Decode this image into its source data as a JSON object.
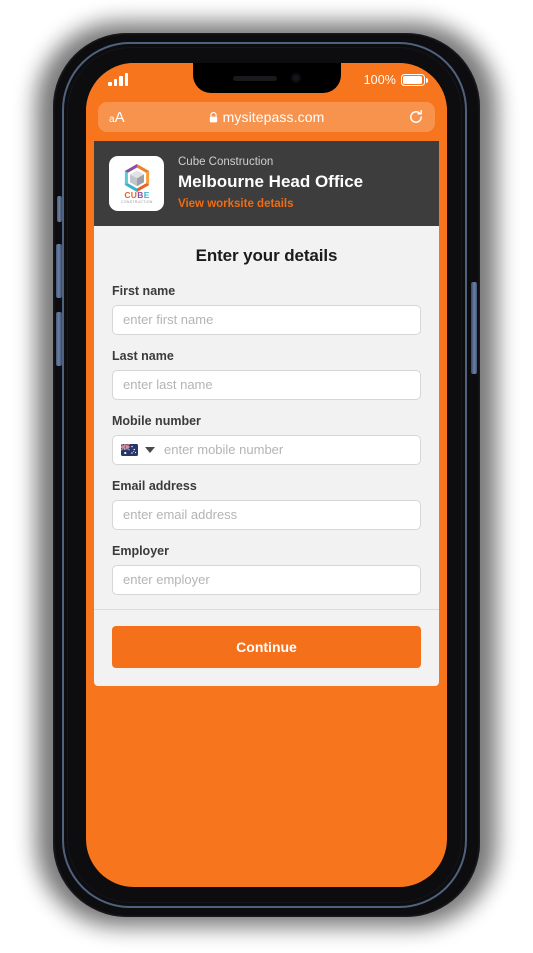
{
  "device": {
    "status_bar": {
      "signal_icon": "cellular-signal-icon",
      "battery_percent": "100%",
      "battery_icon": "battery-full-icon"
    }
  },
  "browser": {
    "text_size_label": "aA",
    "lock_icon": "lock-icon",
    "url": "mysitepass.com",
    "reload_icon": "reload-icon"
  },
  "site_card": {
    "logo_alt": "cube-construction-logo",
    "logo_wordmark": "CUBE",
    "logo_subtext": "CONSTRUCTION",
    "company": "Cube Construction",
    "site_name": "Melbourne Head Office",
    "link_label": "View worksite details"
  },
  "form": {
    "title": "Enter your details",
    "fields": [
      {
        "key": "first-name",
        "label": "First name",
        "placeholder": "enter first name",
        "value": ""
      },
      {
        "key": "last-name",
        "label": "Last name",
        "placeholder": "enter last name",
        "value": ""
      },
      {
        "key": "mobile-number",
        "label": "Mobile number",
        "placeholder": "enter mobile number",
        "value": "",
        "country_flag": "australia-flag-icon",
        "country_dropdown_icon": "chevron-down-icon"
      },
      {
        "key": "email-address",
        "label": "Email address",
        "placeholder": "enter email address",
        "value": ""
      },
      {
        "key": "employer",
        "label": "Employer",
        "placeholder": "enter employer",
        "value": ""
      }
    ],
    "submit_label": "Continue"
  },
  "colors": {
    "brand_orange": "#f7751d",
    "button_orange": "#f4701a",
    "link_orange": "#ef6c12",
    "card_dark": "#3d3d3d",
    "panel_grey": "#f2f2f2"
  }
}
